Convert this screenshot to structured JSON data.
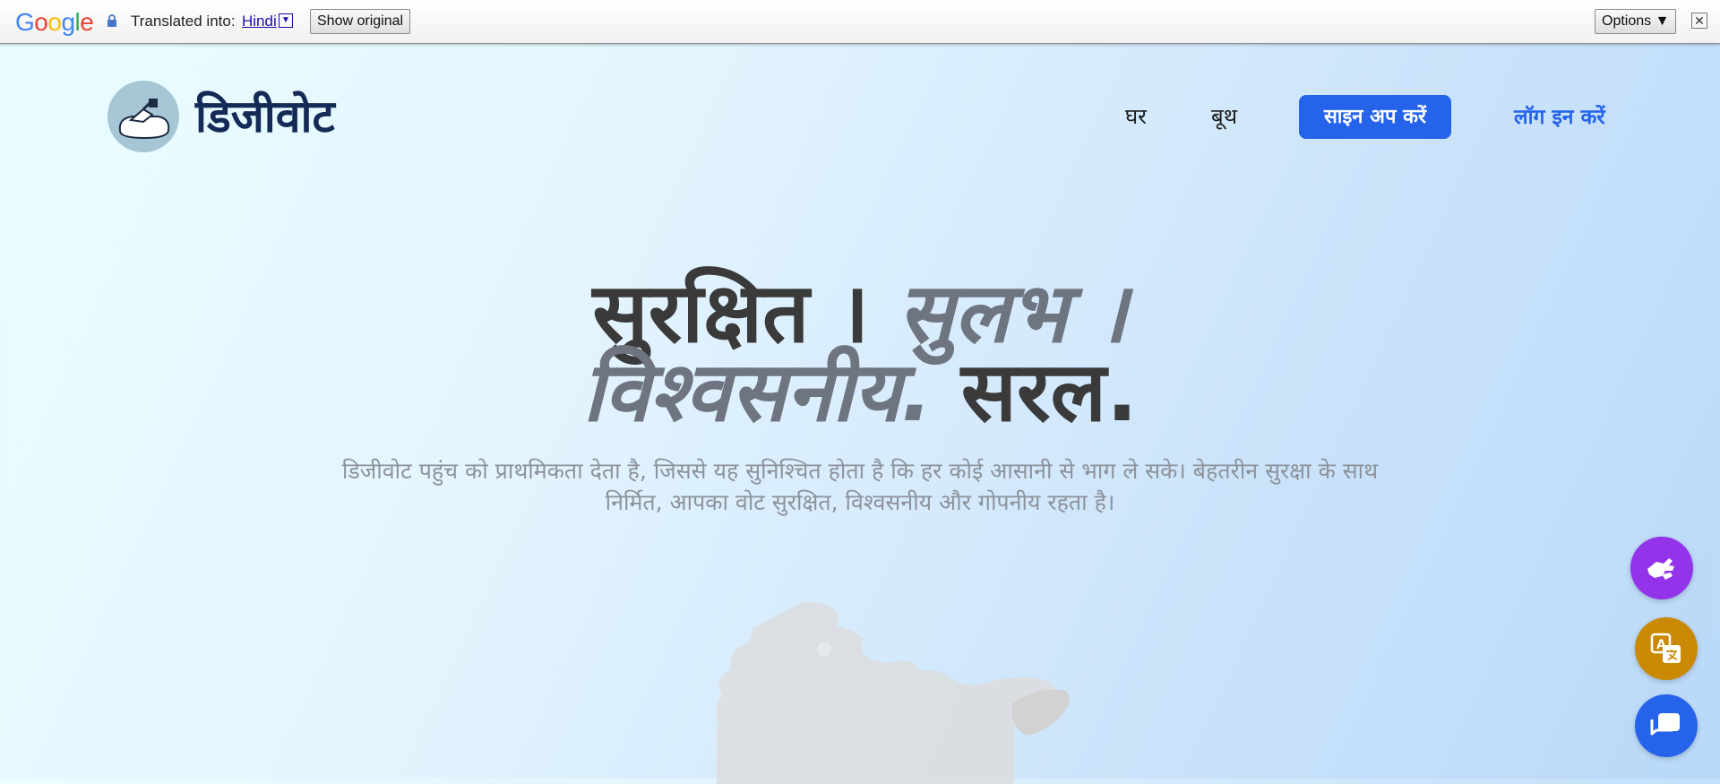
{
  "translate_bar": {
    "logo_letters": [
      "G",
      "o",
      "o",
      "g",
      "l",
      "e"
    ],
    "translated_into_label": "Translated into:",
    "language": "Hindi",
    "language_dropdown_glyph": "▼",
    "show_original_label": "Show original",
    "options_label": "Options ▼",
    "close_glyph": "✕"
  },
  "header": {
    "brand": "डिजीवोट",
    "nav": {
      "home": "घर",
      "booth": "बूथ",
      "signup": "साइन अप करें",
      "login": "लॉग इन करें"
    }
  },
  "hero": {
    "word1": "सुरक्षित",
    "sep1": " । ",
    "word2": "सुलभ",
    "sep2": " ।",
    "word3": "विश्वसनीय.",
    "word4": " सरल.",
    "subtitle": "डिजीवोट पहुंच को प्राथमिकता देता है, जिससे यह सुनिश्चित होता है कि हर कोई आसानी से भाग ले सके। बेहतरीन सुरक्षा के साथ निर्मित, आपका वोट सुरक्षित, विश्वसनीय और गोपनीय रहता है।"
  },
  "floating_buttons": {
    "sign_language_icon": "sign-language-icon",
    "translate_icon": "translate-icon",
    "chat_icon": "chat-icon"
  },
  "colors": {
    "brand_dark": "#142a57",
    "primary_blue": "#2563eb",
    "sign_purple": "#9333ea",
    "translate_gold": "#ca8a04"
  }
}
